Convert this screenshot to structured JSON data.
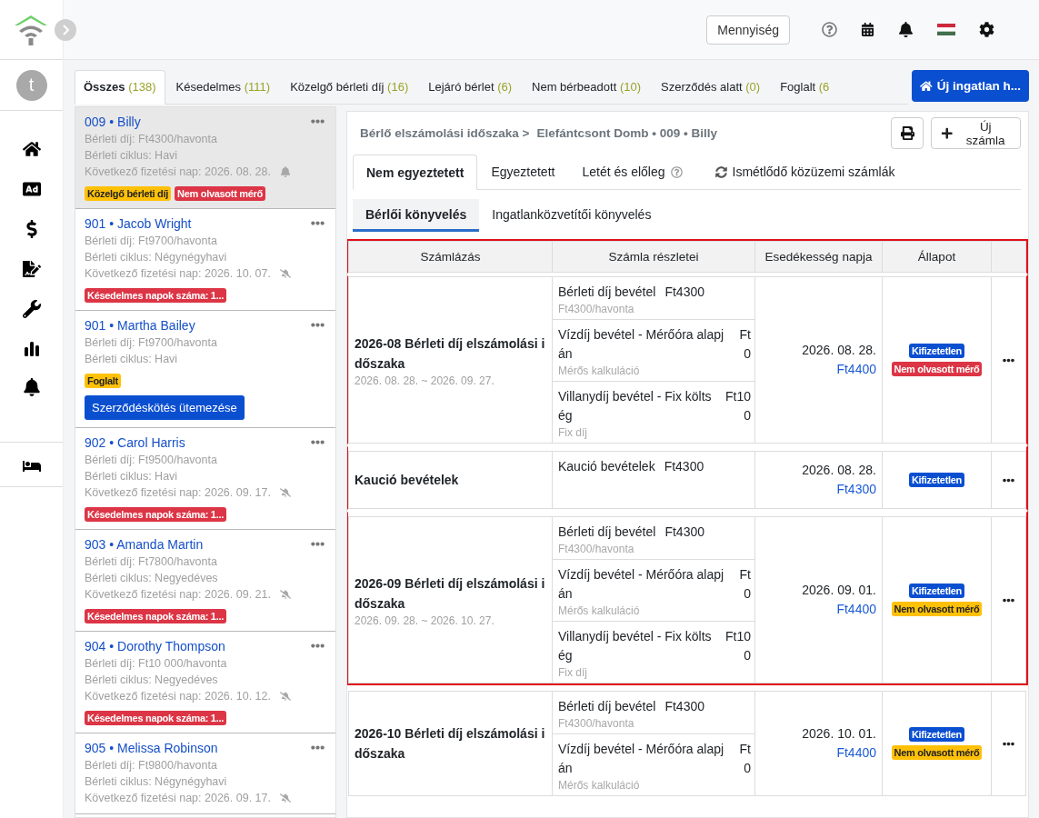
{
  "sidebar": {
    "avatar_letter": "t",
    "nav": [
      {
        "kind": "home"
      },
      {
        "kind": "ad"
      },
      {
        "kind": "dollar"
      },
      {
        "kind": "contract"
      },
      {
        "kind": "wrench"
      },
      {
        "kind": "chart"
      },
      {
        "kind": "bell"
      }
    ],
    "bottom_nav": [
      {
        "kind": "bed"
      }
    ]
  },
  "topbar": {
    "quantity_button": "Mennyiség"
  },
  "filter_tabs": [
    {
      "label": "Összes",
      "count": "(138)",
      "selected": true
    },
    {
      "label": "Késedelmes",
      "count": "(111)",
      "selected": false
    },
    {
      "label": "Közelgő bérleti díj",
      "count": "(16)",
      "selected": false
    },
    {
      "label": "Lejáró bérlet",
      "count": "(6)",
      "selected": false
    },
    {
      "label": "Nem bérbeadott",
      "count": "(10)",
      "selected": false
    },
    {
      "label": "Szerződés alatt",
      "count": "(0)",
      "selected": false
    },
    {
      "label": "Foglalt",
      "count": "(6",
      "selected": false
    }
  ],
  "new_property_button": "Új ingatlan h...",
  "tenants": [
    {
      "title": "009 • Billy",
      "rent": "Bérleti díj: Ft4300/havonta",
      "cycle": "Bérleti ciklus: Havi",
      "next_payment": "Következő fizetési nap:  2026. 08. 28.",
      "reminder_on": true,
      "tags": [
        {
          "text": "Közelgő bérleti díj",
          "kind": "warning"
        },
        {
          "text": "Nem olvasott mérő",
          "kind": "danger"
        }
      ],
      "selected": true
    },
    {
      "title": "901 • Jacob Wright",
      "rent": "Bérleti díj: Ft9700/havonta",
      "cycle": "Bérleti ciklus: Négynégyhavi",
      "next_payment": "Következő fizetési nap:  2026. 10. 07.",
      "reminder_on": false,
      "tags": [
        {
          "text": "Késedelmes napok száma: 1...",
          "kind": "danger"
        }
      ],
      "selected": false
    },
    {
      "title": "901 • Martha Bailey",
      "rent": "Bérleti díj: Ft9700/havonta",
      "cycle": "Bérleti ciklus: Havi",
      "tags": [
        {
          "text": "Foglalt",
          "kind": "warning"
        }
      ],
      "action": "Szerződéskötés ütemezése",
      "selected": false
    },
    {
      "title": "902 • Carol Harris",
      "rent": "Bérleti díj: Ft9500/havonta",
      "cycle": "Bérleti ciklus: Havi",
      "next_payment": "Következő fizetési nap:  2026. 09. 17.",
      "reminder_on": false,
      "tags": [
        {
          "text": "Késedelmes napok száma: 1...",
          "kind": "danger"
        }
      ],
      "selected": false
    },
    {
      "title": "903 • Amanda Martin",
      "rent": "Bérleti díj: Ft7800/havonta",
      "cycle": "Bérleti ciklus: Negyedéves",
      "next_payment": "Következő fizetési nap:  2026. 09. 21.",
      "reminder_on": false,
      "tags": [
        {
          "text": "Késedelmes napok száma: 1...",
          "kind": "danger"
        }
      ],
      "selected": false
    },
    {
      "title": "904 • Dorothy Thompson",
      "rent": "Bérleti díj: Ft10 000/havonta",
      "cycle": "Bérleti ciklus: Negyedéves",
      "next_payment": "Következő fizetési nap:  2026. 10. 12.",
      "reminder_on": false,
      "tags": [
        {
          "text": "Késedelmes napok száma: 1...",
          "kind": "danger"
        }
      ],
      "selected": false
    },
    {
      "title": "905 • Melissa Robinson",
      "rent": "Bérleti díj: Ft9800/havonta",
      "cycle": "Bérleti ciklus: Négynégyhavi",
      "next_payment": "Következő fizetési nap:  2026. 09. 17.",
      "reminder_on": false,
      "selected": false
    }
  ],
  "detail": {
    "breadcrumb": [
      "Bérlő elszámolási időszaka >",
      "Elefántcsont Domb • 009 • Billy"
    ],
    "new_invoice_button": "Új számla",
    "tabs": [
      {
        "label": "Nem egyeztetett",
        "selected": true,
        "kind": "plain"
      },
      {
        "label": "Egyeztetett",
        "selected": false,
        "kind": "plain"
      },
      {
        "label": "Letét és előleg",
        "selected": false,
        "kind": "help"
      },
      {
        "label": "Ismétlődő közüzemi számlák",
        "selected": false,
        "kind": "sync"
      }
    ],
    "subtabs": [
      {
        "label": "Bérlői könyvelés",
        "selected": true
      },
      {
        "label": "Ingatlanközvetítői könyvelés",
        "selected": false
      }
    ],
    "table": {
      "columns": [
        "Számlázás",
        "Számla részletei",
        "Esedékesség napja",
        "Állapot"
      ],
      "groups": [
        {
          "highlighted": true,
          "title": "2026-08 Bérleti díj elszámolási időszaka",
          "period": "2026. 08. 28. ~ 2026. 09. 27.",
          "items": [
            {
              "name": "Bérleti díj bevétel",
              "amount": "Ft4300",
              "note": "Ft4300/havonta"
            },
            {
              "name": "Vízdíj bevétel - Mérőóra alapján",
              "amount": "Ft0",
              "note": "Mérős kalkuláció"
            },
            {
              "name": "Villanydíj bevétel - Fix költség",
              "amount": "Ft100",
              "note": "Fix díj"
            }
          ],
          "due_date": "2026. 08. 28.",
          "due_amount": "Ft4400",
          "statuses": [
            {
              "text": "Kifizetetlen",
              "kind": "primary"
            },
            {
              "text": "Nem olvasott mérő",
              "kind": "danger"
            }
          ]
        },
        {
          "highlighted": true,
          "title": "Kaució bevételek",
          "items": [
            {
              "name": "Kaució bevételek",
              "amount": "Ft4300"
            }
          ],
          "due_date": "2026. 08. 28.",
          "due_amount": "Ft4300",
          "statuses": [
            {
              "text": "Kifizetetlen",
              "kind": "primary"
            }
          ]
        },
        {
          "highlighted": true,
          "title": "2026-09 Bérleti díj elszámolási időszaka",
          "period": "2026. 09. 28. ~ 2026. 10. 27.",
          "items": [
            {
              "name": "Bérleti díj bevétel",
              "amount": "Ft4300",
              "note": "Ft4300/havonta"
            },
            {
              "name": "Vízdíj bevétel - Mérőóra alapján",
              "amount": "Ft0",
              "note": "Mérős kalkuláció"
            },
            {
              "name": "Villanydíj bevétel - Fix költség",
              "amount": "Ft100",
              "note": "Fix díj"
            }
          ],
          "due_date": "2026. 09. 01.",
          "due_amount": "Ft4400",
          "statuses": [
            {
              "text": "Kifizetetlen",
              "kind": "primary"
            },
            {
              "text": "Nem olvasott mérő",
              "kind": "warning"
            }
          ]
        },
        {
          "highlighted": false,
          "title": "2026-10 Bérleti díj elszámolási időszaka",
          "items": [
            {
              "name": "Bérleti díj bevétel",
              "amount": "Ft4300",
              "note": "Ft4300/havonta"
            },
            {
              "name": "Vízdíj bevétel - Mérőóra alapján",
              "amount": "Ft0",
              "note": "Mérős kalkuláció"
            }
          ],
          "due_date": "2026. 10. 01.",
          "due_amount": "Ft4400",
          "statuses": [
            {
              "text": "Kifizetetlen",
              "kind": "primary"
            },
            {
              "text": "Nem olvasott mérő",
              "kind": "warning"
            }
          ]
        }
      ]
    }
  }
}
